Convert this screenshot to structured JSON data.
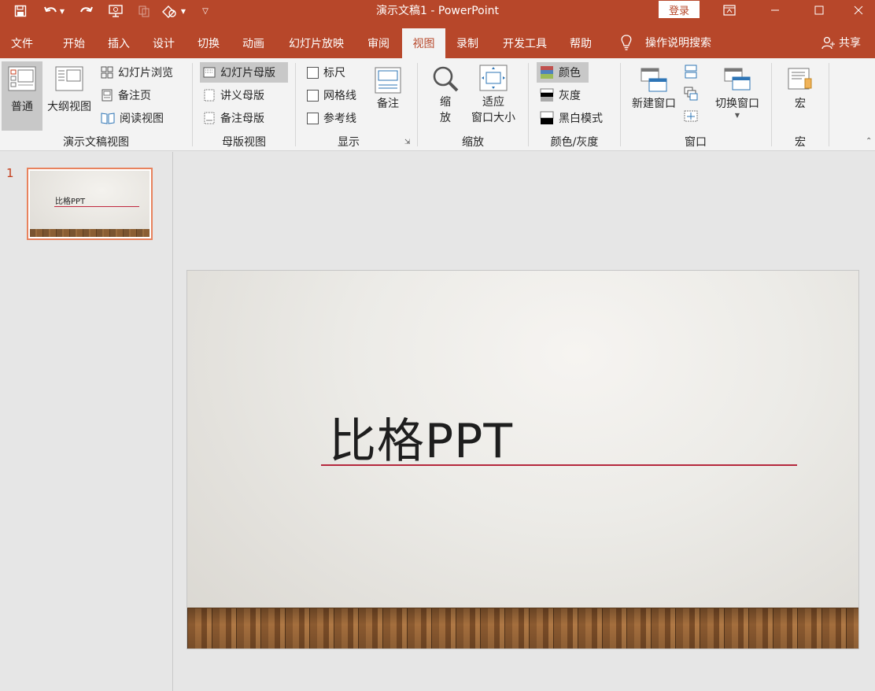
{
  "titlebar": {
    "title": "演示文稿1  -  PowerPoint",
    "login": "登录",
    "colors": {
      "bar": "#b7472a"
    }
  },
  "tabs": [
    {
      "label": "文件"
    },
    {
      "label": "开始"
    },
    {
      "label": "插入"
    },
    {
      "label": "设计"
    },
    {
      "label": "切换"
    },
    {
      "label": "动画"
    },
    {
      "label": "幻灯片放映"
    },
    {
      "label": "审阅"
    },
    {
      "label": "视图"
    },
    {
      "label": "录制"
    },
    {
      "label": "开发工具"
    },
    {
      "label": "帮助"
    }
  ],
  "tell_me": "操作说明搜索",
  "share": "共享",
  "ribbon": {
    "presentation_views": {
      "label": "演示文稿视图",
      "normal": "普通",
      "outline": "大纲视图",
      "slide_sorter": "幻灯片浏览",
      "notes_page": "备注页",
      "reading_view": "阅读视图"
    },
    "master_views": {
      "label": "母版视图",
      "slide_master": "幻灯片母版",
      "handout_master": "讲义母版",
      "notes_master": "备注母版"
    },
    "show": {
      "label": "显示",
      "ruler": "标尺",
      "gridlines": "网格线",
      "guides": "参考线",
      "notes": "备注"
    },
    "zoom": {
      "label": "缩放",
      "zoom_top": "缩",
      "zoom_bottom": "放",
      "fit_top": "适应",
      "fit_bottom": "窗口大小"
    },
    "color": {
      "label": "颜色/灰度",
      "color": "颜色",
      "grayscale": "灰度",
      "bw": "黑白模式"
    },
    "window": {
      "label": "窗口",
      "new_window": "新建窗口",
      "switch_windows": "切换窗口"
    },
    "macros": {
      "label": "宏",
      "macros": "宏"
    }
  },
  "thumbnails": [
    {
      "number": "1",
      "title": "比格PPT"
    }
  ],
  "slide": {
    "title": "比格PPT",
    "colors": {
      "underline": "#b5283d"
    }
  }
}
